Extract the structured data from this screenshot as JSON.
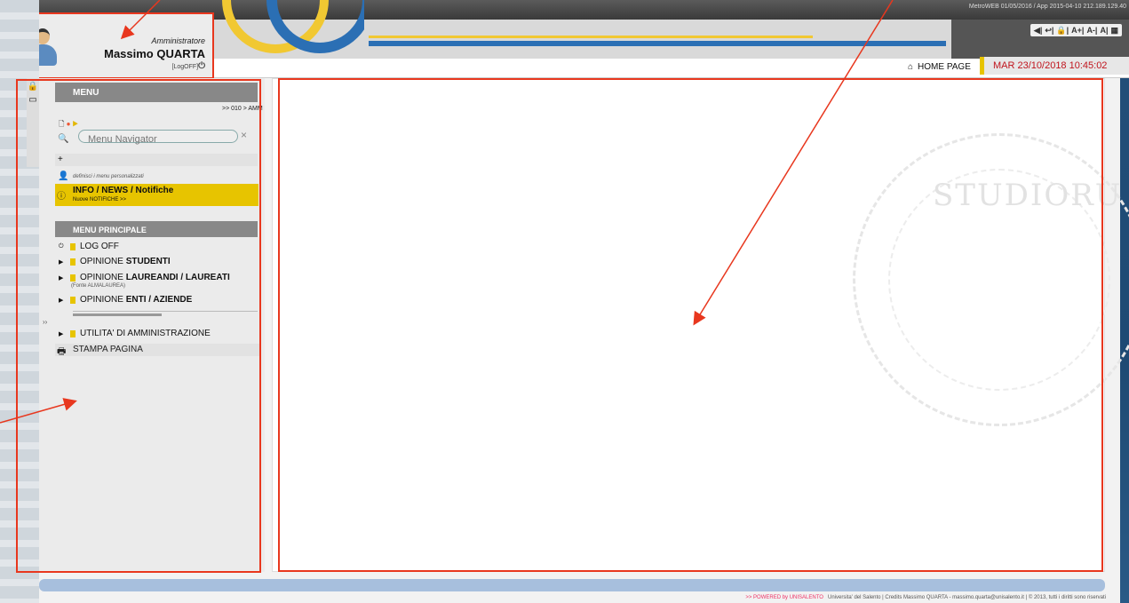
{
  "header": {
    "version_info": "MetroWEB 01/05/2016 / App 2015-04-10 212.189.129.40",
    "access_controls": [
      "◀|",
      "↩|",
      "🔒|",
      "A+|",
      "A-|",
      "A|",
      "▦"
    ],
    "home_label": "HOME PAGE",
    "datetime": "MAR 23/10/2018 10:45:02"
  },
  "user": {
    "role": "Amministratore",
    "name": "Massimo QUARTA",
    "logoff": "[LogOFF]"
  },
  "sidebar": {
    "menu_title": "MENU",
    "breadcrumb": ">> 010 > AMM",
    "search_placeholder": "Menu Navigator",
    "custom_menus_note": "definisci i menu personalizzati",
    "info_title": "INFO / NEWS / Notifiche",
    "info_sub": "Nuove NOTIFICHE  >>",
    "main_menu_title": "MENU PRINCIPALE",
    "items": [
      {
        "label_pre": "LOG OFF",
        "label_bold": ""
      },
      {
        "label_pre": "OPINIONE ",
        "label_bold": "STUDENTI"
      },
      {
        "label_pre": "OPINIONE ",
        "label_bold": "LAUREANDI / LAUREATI"
      },
      {
        "label_pre": "OPINIONE ",
        "label_bold": "ENTI / AZIENDE"
      },
      {
        "label_pre": "UTILITA' DI AMMINISTRAZIONE",
        "label_bold": ""
      }
    ],
    "laureati_note": "(Fonte ALMALAUREA)",
    "print_label": "STAMPA PAGINA"
  },
  "footer": {
    "powered": ">> POWERED by UNISALENTO",
    "credits": "Universita' del Salento  |  Credits Massimo QUARTA - massimo.quarta@unisalento.it | © 2013, tutti i diritti sono riservati"
  },
  "seal_text": "STUDIORU",
  "colors": {
    "accent_red": "#e8371e",
    "yellow": "#e7c400",
    "brand_blue": "#2b6fb4"
  }
}
